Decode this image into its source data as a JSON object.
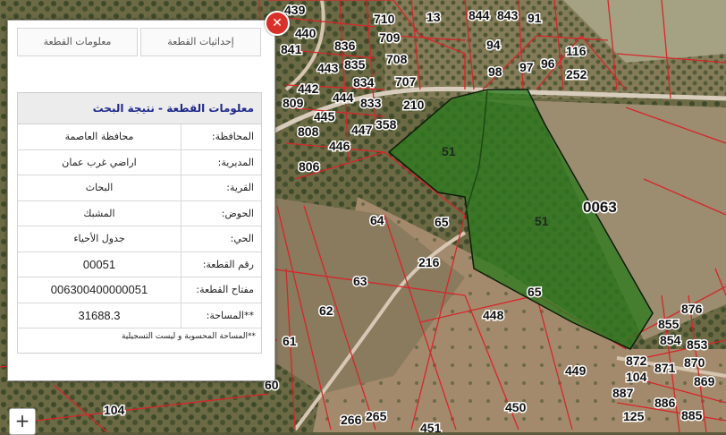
{
  "popup": {
    "close_icon": "x",
    "tabs": [
      {
        "label": "معلومات القطعة"
      },
      {
        "label": "إحداثيات القطعة"
      }
    ],
    "title": "معلومات القطعة - نتيجة البحث",
    "rows": [
      {
        "label": "المحافظة:",
        "value": "محافظة العاصمة"
      },
      {
        "label": "المديرية:",
        "value": "اراضي غرب عمان"
      },
      {
        "label": "القرية:",
        "value": "البحاث"
      },
      {
        "label": "الحوض:",
        "value": "المشبك"
      },
      {
        "label": "الحي:",
        "value": "جدول الأحياء"
      },
      {
        "label": "رقم القطعة:",
        "value": "00051"
      },
      {
        "label": "مفتاح القطعة:",
        "value": "006300400000051"
      },
      {
        "label": "**المساحة:",
        "value": "31688.3"
      }
    ],
    "footnote": "**المساحة المحسوبة و ليست التسجيلية"
  },
  "zoom": {
    "plus_label": "+"
  },
  "map": {
    "block_label": "0063",
    "parcel_labels": [
      "51",
      "51"
    ],
    "labels": [
      "439",
      "440",
      "841",
      "443",
      "442",
      "809",
      "808",
      "806",
      "836",
      "835",
      "834",
      "833",
      "445",
      "444",
      "446",
      "447",
      "358",
      "710",
      "709",
      "708",
      "707",
      "210",
      "13",
      "844",
      "843",
      "91",
      "94",
      "116",
      "98",
      "97",
      "96",
      "252",
      "64",
      "65",
      "216",
      "63",
      "62",
      "61",
      "65",
      "448",
      "449",
      "450",
      "451",
      "266",
      "265",
      "104",
      "60",
      "855",
      "854",
      "853",
      "876",
      "872",
      "871",
      "870",
      "869",
      "887",
      "886",
      "885",
      "125",
      "104"
    ]
  }
}
